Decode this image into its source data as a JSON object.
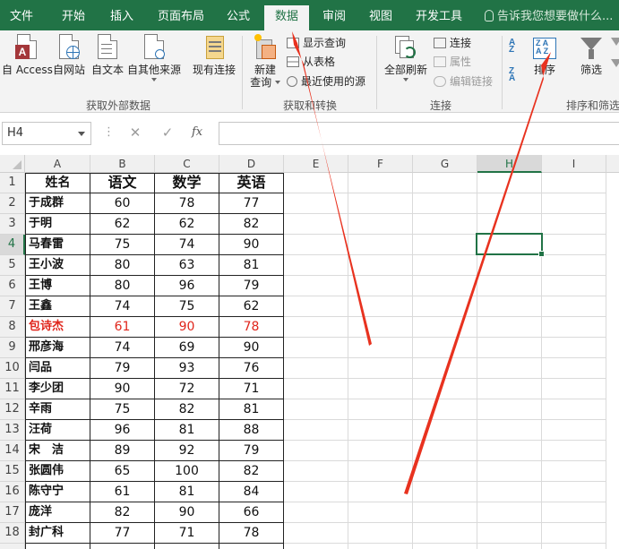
{
  "ribbon_tabs": [
    "文件",
    "开始",
    "插入",
    "页面布局",
    "公式",
    "数据",
    "审阅",
    "视图",
    "开发工具"
  ],
  "tell_me": "告诉我您想要做什么...",
  "get_external": {
    "access": "自 Access",
    "web": "自网站",
    "text": "自文本",
    "other": "自其他来源",
    "existing": "现有连接",
    "group_label": "获取外部数据"
  },
  "get_transform": {
    "new_query_1": "新建",
    "new_query_2": "查询",
    "show_queries": "显示查询",
    "from_table": "从表格",
    "recent_sources": "最近使用的源",
    "group_label": "获取和转换"
  },
  "connections": {
    "refresh_all_1": "全部刷新",
    "connections": "连接",
    "properties": "属性",
    "edit_links": "编辑链接",
    "group_label": "连接"
  },
  "sort_filter": {
    "sort": "排序",
    "filter": "筛选",
    "group_label": "排序和筛选"
  },
  "name_box": "H4",
  "formula_bar": {
    "dots": "⋮",
    "cancel": "✕",
    "enter": "✓",
    "fx": "fx",
    "value": ""
  },
  "columns": [
    "A",
    "B",
    "C",
    "D",
    "E",
    "F",
    "G",
    "H",
    "I"
  ],
  "selected_column": "H",
  "selected_row": 4,
  "header_row": [
    "姓名",
    "语文",
    "数学",
    "英语"
  ],
  "rows": [
    {
      "n": "2",
      "name": "于成群",
      "v": [
        "60",
        "78",
        "77"
      ]
    },
    {
      "n": "3",
      "name": "于明",
      "v": [
        "62",
        "62",
        "82"
      ]
    },
    {
      "n": "4",
      "name": "马春雷",
      "v": [
        "75",
        "74",
        "90"
      ]
    },
    {
      "n": "5",
      "name": "王小波",
      "v": [
        "80",
        "63",
        "81"
      ]
    },
    {
      "n": "6",
      "name": "王博",
      "v": [
        "80",
        "96",
        "79"
      ]
    },
    {
      "n": "7",
      "name": "王鑫",
      "v": [
        "74",
        "75",
        "62"
      ]
    },
    {
      "n": "8",
      "name": "包诗杰",
      "v": [
        "61",
        "90",
        "78"
      ],
      "red": true
    },
    {
      "n": "9",
      "name": "邢彦海",
      "v": [
        "74",
        "69",
        "90"
      ]
    },
    {
      "n": "10",
      "name": "闫品",
      "v": [
        "79",
        "93",
        "76"
      ]
    },
    {
      "n": "11",
      "name": "李少团",
      "v": [
        "90",
        "72",
        "71"
      ]
    },
    {
      "n": "12",
      "name": "辛雨",
      "v": [
        "75",
        "82",
        "81"
      ]
    },
    {
      "n": "13",
      "name": "汪荷",
      "v": [
        "96",
        "81",
        "88"
      ]
    },
    {
      "n": "14",
      "name": "宋　洁",
      "v": [
        "89",
        "92",
        "79"
      ]
    },
    {
      "n": "15",
      "name": "张圆伟",
      "v": [
        "65",
        "100",
        "82"
      ]
    },
    {
      "n": "16",
      "name": "陈守宁",
      "v": [
        "61",
        "81",
        "84"
      ]
    },
    {
      "n": "17",
      "name": "庞洋",
      "v": [
        "82",
        "90",
        "66"
      ]
    },
    {
      "n": "18",
      "name": "封广科",
      "v": [
        "77",
        "71",
        "78"
      ]
    }
  ],
  "colors": {
    "excel_green": "#217346",
    "red_text": "#e0261c",
    "arrow": "#e8321f"
  }
}
